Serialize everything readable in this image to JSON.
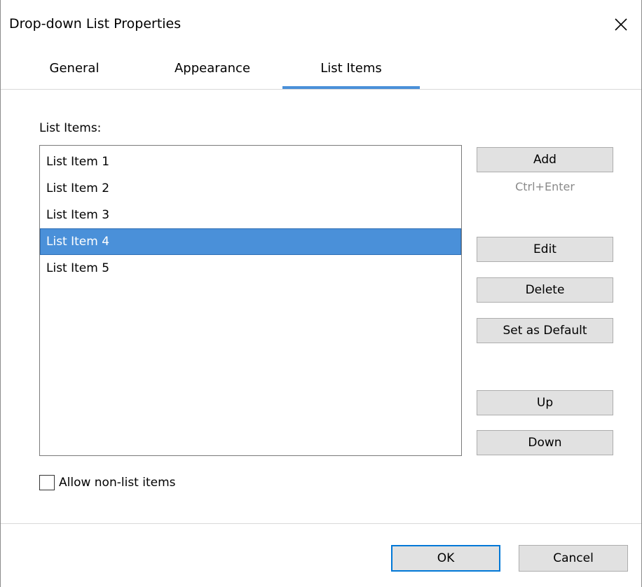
{
  "window": {
    "title": "Drop-down List Properties",
    "close_icon": "close-icon"
  },
  "tabs": [
    {
      "label": "General",
      "active": false
    },
    {
      "label": "Appearance",
      "active": false
    },
    {
      "label": "List Items",
      "active": true
    }
  ],
  "list_items_panel": {
    "label": "List Items:",
    "items": [
      {
        "label": "List Item 1",
        "selected": false
      },
      {
        "label": "List Item 2",
        "selected": false
      },
      {
        "label": "List Item 3",
        "selected": false
      },
      {
        "label": "List Item 4",
        "selected": true
      },
      {
        "label": "List Item 5",
        "selected": false
      }
    ]
  },
  "buttons": {
    "add": "Add",
    "add_hint": "Ctrl+Enter",
    "edit": "Edit",
    "delete": "Delete",
    "set_default": "Set as Default",
    "up": "Up",
    "down": "Down"
  },
  "allow_non_list": {
    "label": "Allow non-list items",
    "checked": false
  },
  "footer": {
    "ok": "OK",
    "cancel": "Cancel"
  },
  "colors": {
    "accent": "#4a90d9",
    "selection": "#4a90d9",
    "default_button_border": "#0078d7",
    "hint_text": "#8a8a8a"
  }
}
